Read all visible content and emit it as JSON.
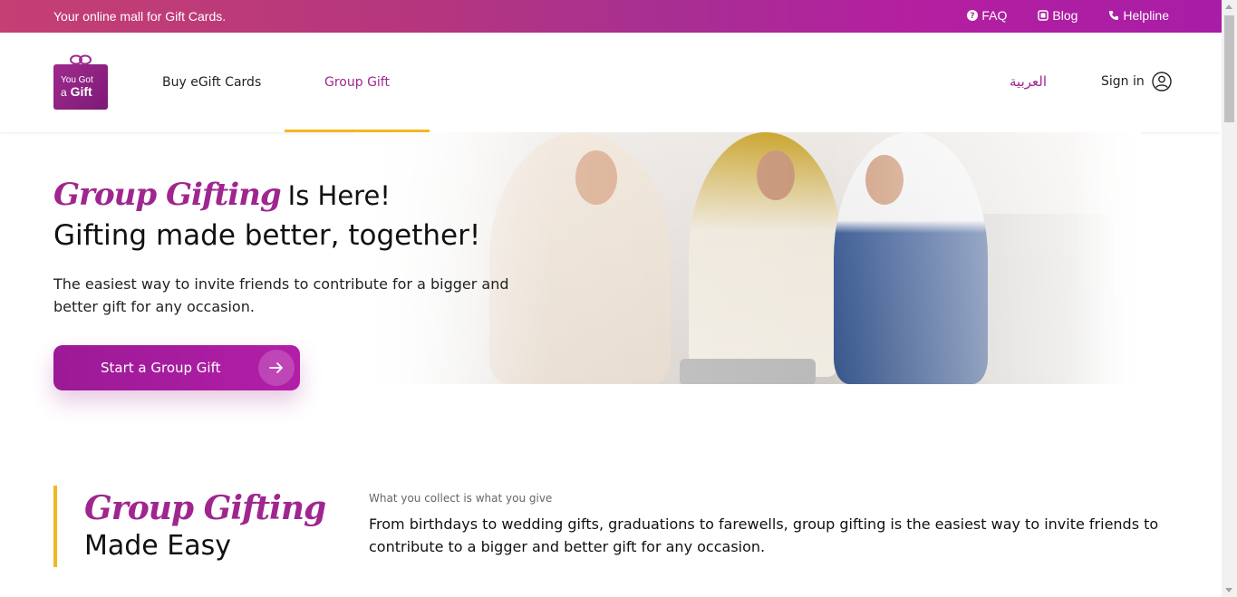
{
  "topbar": {
    "tagline": "Your online mall for Gift Cards.",
    "links": [
      {
        "label": "FAQ",
        "icon": "question-circle-icon"
      },
      {
        "label": "Blog",
        "icon": "blog-icon"
      },
      {
        "label": "Helpline",
        "icon": "phone-icon"
      }
    ]
  },
  "header": {
    "logo": {
      "line1": "You Got",
      "line2_a": "a",
      "line2_b": "Gift"
    },
    "nav": [
      {
        "label": "Buy eGift Cards",
        "active": false
      },
      {
        "label": "Group Gift",
        "active": true
      }
    ],
    "language": "العربية",
    "signin": "Sign in"
  },
  "hero": {
    "script_title": "Group Gifting",
    "title_rest": "Is Here!",
    "title2": "Gifting made better, together!",
    "description": "The easiest way to invite friends to contribute for a bigger and better gift for any occasion.",
    "cta_label": "Start a Group Gift"
  },
  "section": {
    "script_title": "Group Gifting",
    "title": "Made Easy",
    "kicker": "What you collect is what you give",
    "text": "From birthdays to wedding gifts, graduations to farewells, group gifting is the easiest way to invite friends to contribute to a bigger and better gift for any occasion."
  },
  "colors": {
    "brand": "#a0268f",
    "accent": "#f2b823",
    "topbar_start": "#c43f73",
    "topbar_end": "#a81da6"
  }
}
